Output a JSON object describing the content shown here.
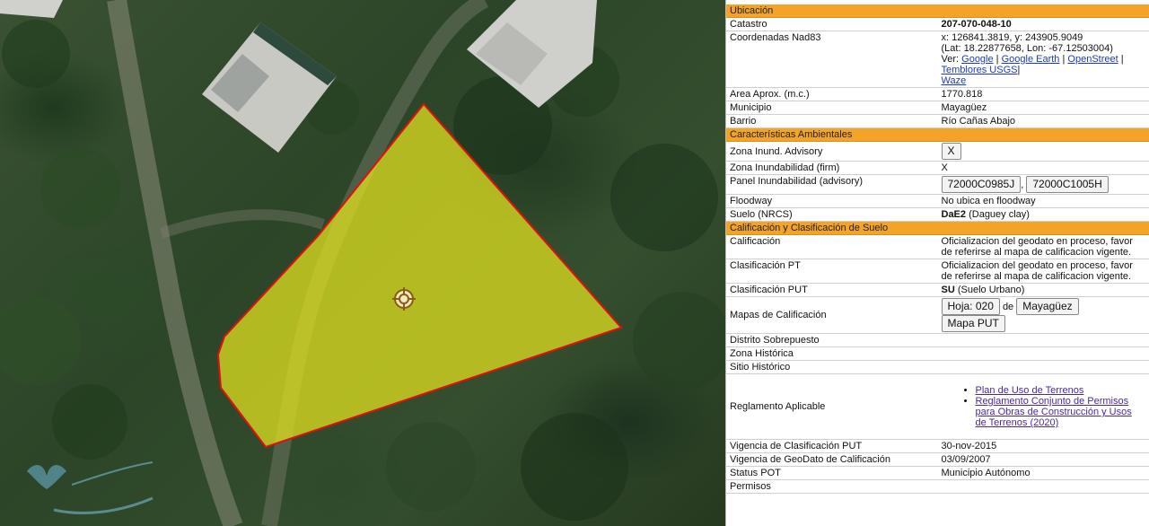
{
  "panel": {
    "sections": {
      "ubicacion": "Ubicación",
      "ambientales": "Características Ambientales",
      "calificacion": "Calificación y Clasificación de Suelo"
    },
    "catastro": {
      "label": "Catastro",
      "value": "207-070-048-10"
    },
    "coordenadas": {
      "label": "Coordenadas Nad83",
      "xy": "x: 126841.3819, y: 243905.9049",
      "latlon": "(Lat: 18.22877658, Lon: -67.12503004)",
      "ver": "Ver:",
      "links": [
        "Google",
        "Google Earth",
        "OpenStreet",
        "Temblores USGS",
        "Waze"
      ]
    },
    "area": {
      "label": "Area Aprox. (m.c.)",
      "value": "1770.818"
    },
    "municipio": {
      "label": "Municipio",
      "value": "Mayagüez"
    },
    "barrio": {
      "label": "Barrio",
      "value": "Río Cañas Abajo"
    },
    "zona_advisory": {
      "label": "Zona Inund. Advisory",
      "button": "X"
    },
    "zona_firm": {
      "label": "Zona Inundabilidad (firm)",
      "value": "X"
    },
    "panel_inund": {
      "label": "Panel Inundabilidad (advisory)",
      "buttons": [
        "72000C0985J",
        "72000C1005H"
      ],
      "sep": ","
    },
    "floodway": {
      "label": "Floodway",
      "value": "No ubica en floodway"
    },
    "suelo": {
      "label": "Suelo (NRCS)",
      "code": "DaE2",
      "desc": "(Daguey clay)"
    },
    "calif": {
      "label": "Calificación",
      "value": "Oficializacion del geodato en proceso, favor de referirse al mapa de calificacion vigente."
    },
    "clas_pt": {
      "label": "Clasificación PT",
      "value": "Oficializacion del geodato en proceso, favor de referirse al mapa de calificacion vigente."
    },
    "clas_put": {
      "label": "Clasificación PUT",
      "code": "SU",
      "desc": "(Suelo Urbano)"
    },
    "mapas": {
      "label": "Mapas de Calificación",
      "hoja": "Hoja: 020",
      "de": "de",
      "muni": "Mayagüez",
      "put": "Mapa PUT"
    },
    "distrito": {
      "label": "Distrito Sobrepuesto"
    },
    "zona_hist": {
      "label": "Zona Histórica"
    },
    "sitio_hist": {
      "label": "Sitio Histórico"
    },
    "reglamento": {
      "label": "Reglamento Aplicable",
      "items": [
        "Plan de Uso de Terrenos",
        "Reglamento Conjunto de Permisos para Obras de Construcción y Usos de Terrenos (2020)"
      ]
    },
    "vigencia_put": {
      "label": "Vigencia de Clasificación PUT",
      "value": "30-nov-2015"
    },
    "vigencia_geo": {
      "label": "Vigencia de GeoDato de Calificación",
      "value": "03/09/2007"
    },
    "status_pot": {
      "label": "Status POT",
      "value": "Municipio Autónomo"
    },
    "permisos": {
      "label": "Permisos"
    }
  },
  "colors": {
    "header": "#f3a428",
    "parcel_fill": "#e6e61e",
    "parcel_stroke": "#e01010",
    "link": "#1a3bbd"
  },
  "icons": {
    "parcel_center": "crosshair-target-icon",
    "watermark": "logo-watermark"
  }
}
